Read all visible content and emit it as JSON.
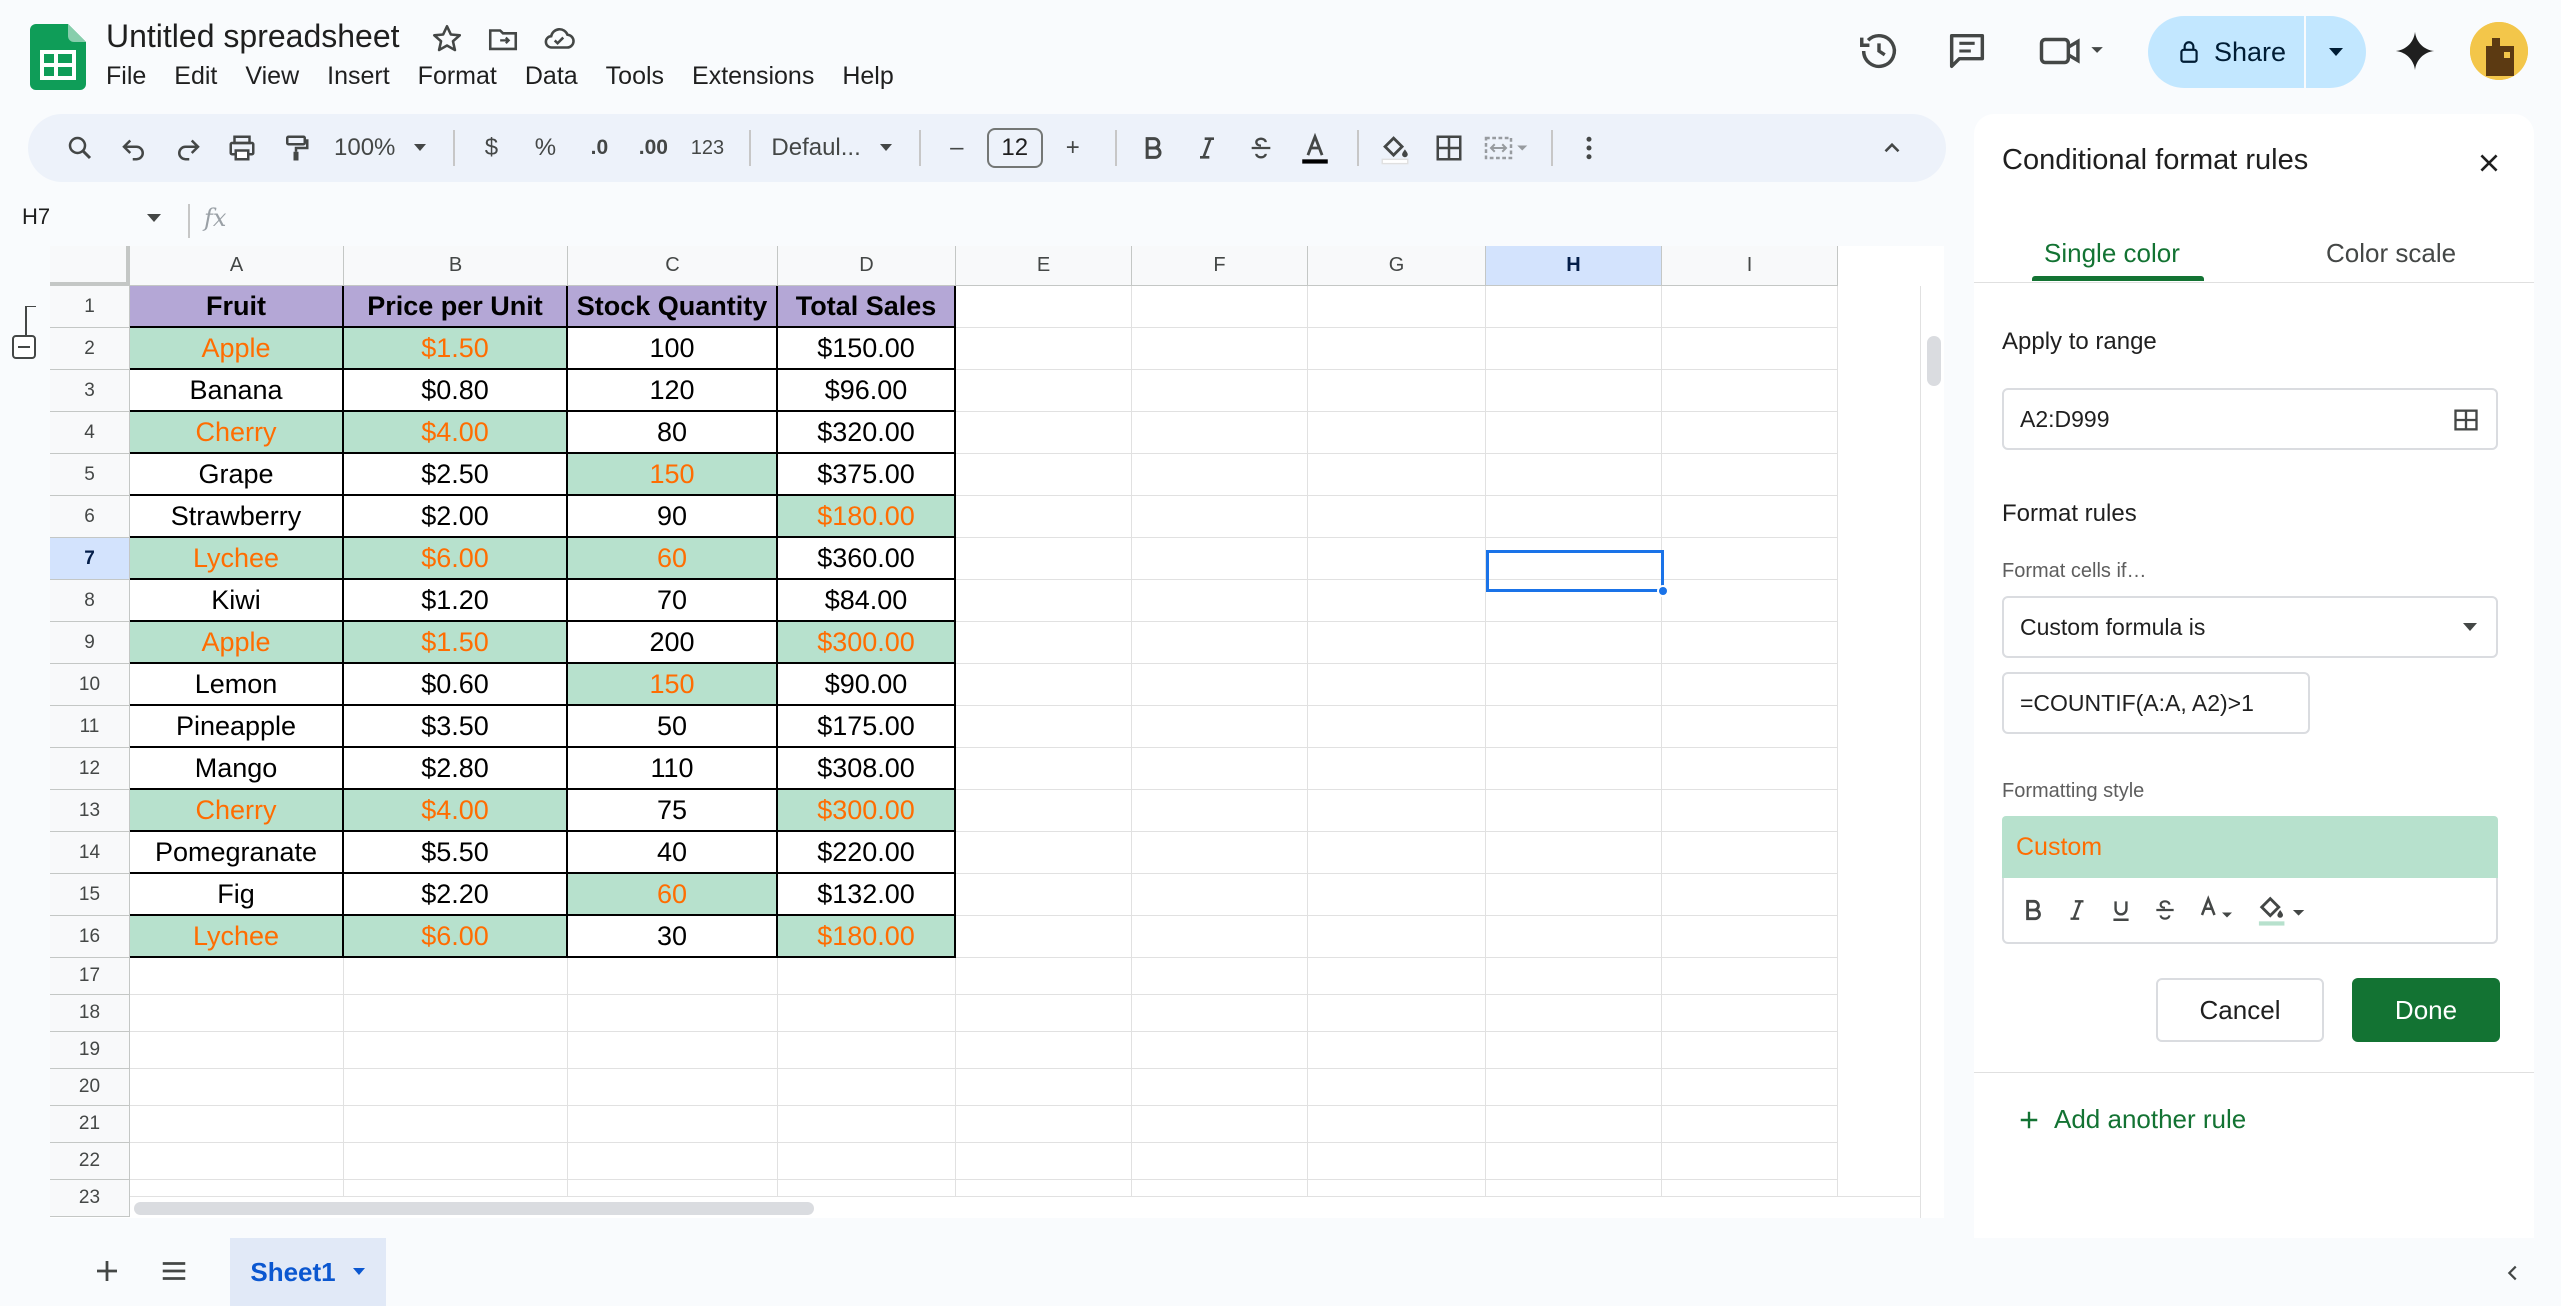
{
  "app": {
    "doc_title": "Untitled spreadsheet"
  },
  "menu": [
    "File",
    "Edit",
    "View",
    "Insert",
    "Format",
    "Data",
    "Tools",
    "Extensions",
    "Help"
  ],
  "header": {
    "share_label": "Share"
  },
  "toolbar": {
    "zoom": "100%",
    "currency": "$",
    "percent": "%",
    "dec_decrease": ".0",
    "dec_increase": ".00",
    "number_format": "123",
    "font": "Defaul...",
    "font_size": "12",
    "minus": "–",
    "plus": "+"
  },
  "formula_bar": {
    "cell_ref": "H7",
    "fx": "fx"
  },
  "grid": {
    "columns": [
      "A",
      "B",
      "C",
      "D",
      "E",
      "F",
      "G",
      "H",
      "I"
    ],
    "selected_column": "H",
    "selected_row": "7",
    "rows": [
      "1",
      "2",
      "3",
      "4",
      "5",
      "6",
      "7",
      "8",
      "9",
      "10",
      "11",
      "12",
      "13",
      "14",
      "15",
      "16",
      "17",
      "18",
      "19",
      "20",
      "21",
      "22",
      "23"
    ],
    "header": [
      "Fruit",
      "Price per Unit",
      "Stock Quantity",
      "Total Sales"
    ],
    "data": [
      [
        "Apple",
        "$1.50",
        "100",
        "$150.00"
      ],
      [
        "Banana",
        "$0.80",
        "120",
        "$96.00"
      ],
      [
        "Cherry",
        "$4.00",
        "80",
        "$320.00"
      ],
      [
        "Grape",
        "$2.50",
        "150",
        "$375.00"
      ],
      [
        "Strawberry",
        "$2.00",
        "90",
        "$180.00"
      ],
      [
        "Lychee",
        "$6.00",
        "60",
        "$360.00"
      ],
      [
        "Kiwi",
        "$1.20",
        "70",
        "$84.00"
      ],
      [
        "Apple",
        "$1.50",
        "200",
        "$300.00"
      ],
      [
        "Lemon",
        "$0.60",
        "150",
        "$90.00"
      ],
      [
        "Pineapple",
        "$3.50",
        "50",
        "$175.00"
      ],
      [
        "Mango",
        "$2.80",
        "110",
        "$308.00"
      ],
      [
        "Cherry",
        "$4.00",
        "75",
        "$300.00"
      ],
      [
        "Pomegranate",
        "$5.50",
        "40",
        "$220.00"
      ],
      [
        "Fig",
        "$2.20",
        "60",
        "$132.00"
      ],
      [
        "Lychee",
        "$6.00",
        "30",
        "$180.00"
      ]
    ],
    "highlighted": [
      [
        true,
        true,
        false,
        false
      ],
      [
        false,
        false,
        false,
        false
      ],
      [
        true,
        true,
        false,
        false
      ],
      [
        false,
        false,
        true,
        false
      ],
      [
        false,
        false,
        false,
        true
      ],
      [
        true,
        true,
        true,
        false
      ],
      [
        false,
        false,
        false,
        false
      ],
      [
        true,
        true,
        false,
        true
      ],
      [
        false,
        false,
        true,
        false
      ],
      [
        false,
        false,
        false,
        false
      ],
      [
        false,
        false,
        false,
        false
      ],
      [
        true,
        true,
        false,
        true
      ],
      [
        false,
        false,
        false,
        false
      ],
      [
        false,
        false,
        true,
        false
      ],
      [
        true,
        true,
        false,
        true
      ]
    ],
    "colors": {
      "header_bg": "#b4a7d6",
      "highlight_bg": "#b7e1cd",
      "highlight_text": "#ff6d01"
    }
  },
  "panel": {
    "title": "Conditional format rules",
    "tab_single": "Single color",
    "tab_scale": "Color scale",
    "apply_label": "Apply to range",
    "range_value": "A2:D999",
    "format_rules_label": "Format rules",
    "format_if_label": "Format cells if…",
    "condition": "Custom formula is",
    "formula": "=COUNTIF(A:A, A2)>1",
    "style_label": "Formatting style",
    "preview_text": "Custom",
    "cancel": "Cancel",
    "done": "Done",
    "add_rule": "Add another rule",
    "accent": "#137333"
  },
  "sheets": {
    "active": "Sheet1"
  }
}
